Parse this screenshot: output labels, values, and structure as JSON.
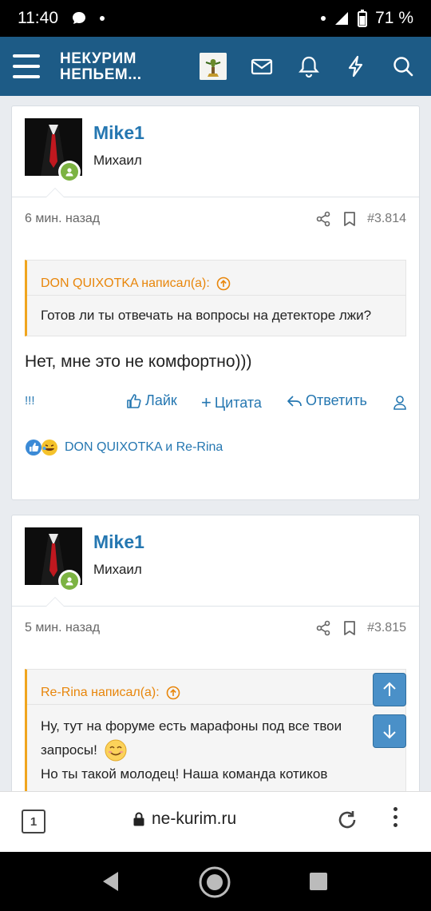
{
  "status": {
    "time": "11:40",
    "battery": "71 %"
  },
  "appbar": {
    "logo_line1": "НЕКУРИМ",
    "logo_line2": "НЕПЬЕМ..."
  },
  "posts": [
    {
      "username": "Mike1",
      "user_title": "Михаил",
      "time": "6 мин. назад",
      "number": "#3.814",
      "quote_author": "DON QUIXOTKA написал(а):",
      "quote_text": "Готов ли ты отвечать на вопросы на детекторе лжи?",
      "message": "Нет, мне это не комфортно)))",
      "bang": "!!!",
      "like_label": "Лайк",
      "quote_label": "Цитата",
      "reply_label": "Ответить",
      "reactions_text": "DON QUIXOTKA и Re-Rina"
    },
    {
      "username": "Mike1",
      "user_title": "Михаил",
      "time": "5 мин. назад",
      "number": "#3.815",
      "quote_author": "Re-Rina написал(а):",
      "quote_line1": "Ну, тут на форуме есть марафоны под все твои",
      "quote_line2": "запросы!",
      "quote_line3": "Но ты такой молодец! Наша команда котиков"
    }
  ],
  "browser": {
    "tab_count": "1",
    "url": "ne-kurim.ru"
  },
  "colors": {
    "brand": "#1d5b86",
    "link": "#2577b1",
    "quote_accent": "#f0a51e",
    "online": "#7cb342"
  }
}
